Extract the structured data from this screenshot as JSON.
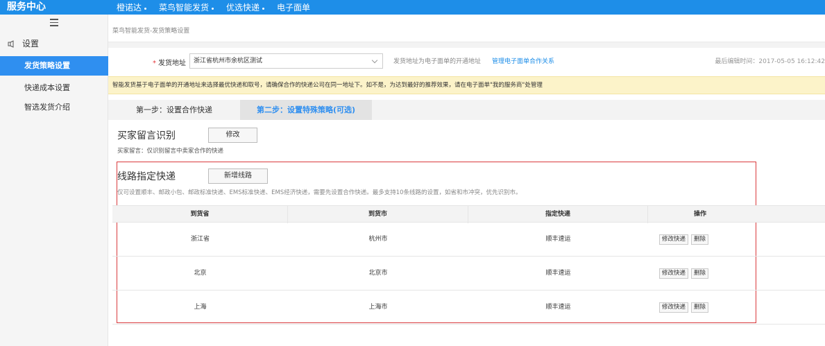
{
  "topbar": {
    "brand": "服务中心",
    "nav": [
      {
        "label": "橙诺达"
      },
      {
        "label": "菜鸟智能发货"
      },
      {
        "label": "优选快递"
      },
      {
        "label": "电子面单"
      }
    ]
  },
  "sidebar": {
    "heading": "设置",
    "items": [
      {
        "label": "发货策略设置",
        "active": true
      },
      {
        "label": "快递成本设置"
      },
      {
        "label": "智选发货介绍"
      }
    ]
  },
  "breadcrumb": "菜鸟智能发货-发货策略设置",
  "address": {
    "label": "发货地址",
    "value": "浙江省杭州市余杭区测试",
    "note": "发货地址为电子面单的开通地址",
    "link": "管理电子面单合作关系",
    "last_edit": "最后编辑时间：2017-05-05 16:12:42"
  },
  "notice": "智能发货基于电子面单的开通地址来选择最优快递和取号，请确保合作的快递公司在同一地址下。如不是，为达到最好的推荐效果，请在电子面单\"我的服务商\"处管理",
  "tabs": [
    {
      "label": "第一步：设置合作快递"
    },
    {
      "label": "第二步：设置特殊策略(可选)"
    }
  ],
  "buyer_note": {
    "title": "买家留言识别",
    "button": "修改",
    "hint": "买家留言：仅识别留言中卖家合作的快递"
  },
  "route": {
    "title": "线路指定快递",
    "button": "新增线路",
    "hint": "仅可设置顺丰、邮政小包、邮政标准快递、EMS标准快递、EMS经济快递，需要先设置合作快递。最多支持10条线路的设置，如省和市冲突，优先识别市。"
  },
  "table": {
    "headers": [
      "到货省",
      "到货市",
      "指定快递",
      "操作"
    ],
    "rows": [
      {
        "province": "浙江省",
        "city": "杭州市",
        "express": "顺丰速运"
      },
      {
        "province": "北京",
        "city": "北京市",
        "express": "顺丰速运"
      },
      {
        "province": "上海",
        "city": "上海市",
        "express": "顺丰速运"
      }
    ],
    "edit_label": "修改快递",
    "delete_label": "删除"
  }
}
